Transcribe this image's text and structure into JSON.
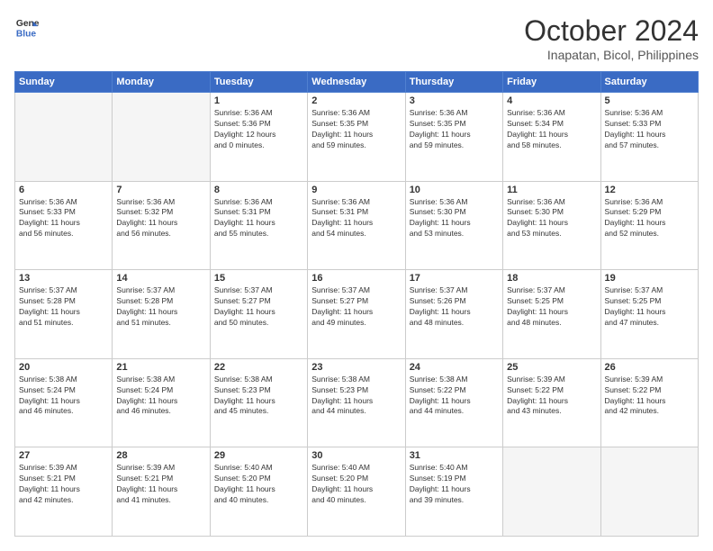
{
  "header": {
    "logo_line1": "General",
    "logo_line2": "Blue",
    "month": "October 2024",
    "location": "Inapatan, Bicol, Philippines"
  },
  "days_of_week": [
    "Sunday",
    "Monday",
    "Tuesday",
    "Wednesday",
    "Thursday",
    "Friday",
    "Saturday"
  ],
  "weeks": [
    [
      {
        "day": "",
        "info": ""
      },
      {
        "day": "",
        "info": ""
      },
      {
        "day": "1",
        "info": "Sunrise: 5:36 AM\nSunset: 5:36 PM\nDaylight: 12 hours\nand 0 minutes."
      },
      {
        "day": "2",
        "info": "Sunrise: 5:36 AM\nSunset: 5:35 PM\nDaylight: 11 hours\nand 59 minutes."
      },
      {
        "day": "3",
        "info": "Sunrise: 5:36 AM\nSunset: 5:35 PM\nDaylight: 11 hours\nand 59 minutes."
      },
      {
        "day": "4",
        "info": "Sunrise: 5:36 AM\nSunset: 5:34 PM\nDaylight: 11 hours\nand 58 minutes."
      },
      {
        "day": "5",
        "info": "Sunrise: 5:36 AM\nSunset: 5:33 PM\nDaylight: 11 hours\nand 57 minutes."
      }
    ],
    [
      {
        "day": "6",
        "info": "Sunrise: 5:36 AM\nSunset: 5:33 PM\nDaylight: 11 hours\nand 56 minutes."
      },
      {
        "day": "7",
        "info": "Sunrise: 5:36 AM\nSunset: 5:32 PM\nDaylight: 11 hours\nand 56 minutes."
      },
      {
        "day": "8",
        "info": "Sunrise: 5:36 AM\nSunset: 5:31 PM\nDaylight: 11 hours\nand 55 minutes."
      },
      {
        "day": "9",
        "info": "Sunrise: 5:36 AM\nSunset: 5:31 PM\nDaylight: 11 hours\nand 54 minutes."
      },
      {
        "day": "10",
        "info": "Sunrise: 5:36 AM\nSunset: 5:30 PM\nDaylight: 11 hours\nand 53 minutes."
      },
      {
        "day": "11",
        "info": "Sunrise: 5:36 AM\nSunset: 5:30 PM\nDaylight: 11 hours\nand 53 minutes."
      },
      {
        "day": "12",
        "info": "Sunrise: 5:36 AM\nSunset: 5:29 PM\nDaylight: 11 hours\nand 52 minutes."
      }
    ],
    [
      {
        "day": "13",
        "info": "Sunrise: 5:37 AM\nSunset: 5:28 PM\nDaylight: 11 hours\nand 51 minutes."
      },
      {
        "day": "14",
        "info": "Sunrise: 5:37 AM\nSunset: 5:28 PM\nDaylight: 11 hours\nand 51 minutes."
      },
      {
        "day": "15",
        "info": "Sunrise: 5:37 AM\nSunset: 5:27 PM\nDaylight: 11 hours\nand 50 minutes."
      },
      {
        "day": "16",
        "info": "Sunrise: 5:37 AM\nSunset: 5:27 PM\nDaylight: 11 hours\nand 49 minutes."
      },
      {
        "day": "17",
        "info": "Sunrise: 5:37 AM\nSunset: 5:26 PM\nDaylight: 11 hours\nand 48 minutes."
      },
      {
        "day": "18",
        "info": "Sunrise: 5:37 AM\nSunset: 5:25 PM\nDaylight: 11 hours\nand 48 minutes."
      },
      {
        "day": "19",
        "info": "Sunrise: 5:37 AM\nSunset: 5:25 PM\nDaylight: 11 hours\nand 47 minutes."
      }
    ],
    [
      {
        "day": "20",
        "info": "Sunrise: 5:38 AM\nSunset: 5:24 PM\nDaylight: 11 hours\nand 46 minutes."
      },
      {
        "day": "21",
        "info": "Sunrise: 5:38 AM\nSunset: 5:24 PM\nDaylight: 11 hours\nand 46 minutes."
      },
      {
        "day": "22",
        "info": "Sunrise: 5:38 AM\nSunset: 5:23 PM\nDaylight: 11 hours\nand 45 minutes."
      },
      {
        "day": "23",
        "info": "Sunrise: 5:38 AM\nSunset: 5:23 PM\nDaylight: 11 hours\nand 44 minutes."
      },
      {
        "day": "24",
        "info": "Sunrise: 5:38 AM\nSunset: 5:22 PM\nDaylight: 11 hours\nand 44 minutes."
      },
      {
        "day": "25",
        "info": "Sunrise: 5:39 AM\nSunset: 5:22 PM\nDaylight: 11 hours\nand 43 minutes."
      },
      {
        "day": "26",
        "info": "Sunrise: 5:39 AM\nSunset: 5:22 PM\nDaylight: 11 hours\nand 42 minutes."
      }
    ],
    [
      {
        "day": "27",
        "info": "Sunrise: 5:39 AM\nSunset: 5:21 PM\nDaylight: 11 hours\nand 42 minutes."
      },
      {
        "day": "28",
        "info": "Sunrise: 5:39 AM\nSunset: 5:21 PM\nDaylight: 11 hours\nand 41 minutes."
      },
      {
        "day": "29",
        "info": "Sunrise: 5:40 AM\nSunset: 5:20 PM\nDaylight: 11 hours\nand 40 minutes."
      },
      {
        "day": "30",
        "info": "Sunrise: 5:40 AM\nSunset: 5:20 PM\nDaylight: 11 hours\nand 40 minutes."
      },
      {
        "day": "31",
        "info": "Sunrise: 5:40 AM\nSunset: 5:19 PM\nDaylight: 11 hours\nand 39 minutes."
      },
      {
        "day": "",
        "info": ""
      },
      {
        "day": "",
        "info": ""
      }
    ]
  ]
}
